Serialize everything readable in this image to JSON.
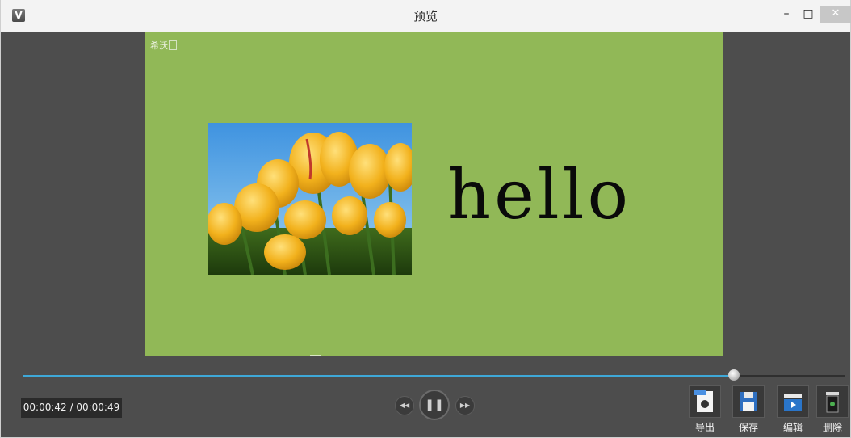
{
  "window": {
    "title": "预览",
    "app_icon": "V",
    "minimize": "–",
    "maximize": "□",
    "close": "✕"
  },
  "preview": {
    "background_color": "#91b857",
    "watermark": "希沃",
    "text": "hello",
    "image": "tulips-photo"
  },
  "playback": {
    "time": "00:00:42 / 00:00:49",
    "progress": 0.865,
    "accent_color": "#3ea8d8",
    "rewind_icon": "rewind-icon",
    "pause_icon": "pause-icon",
    "forward_icon": "fast-forward-icon"
  },
  "actions": [
    {
      "label": "导出",
      "icon": "export-mp4-icon"
    },
    {
      "label": "保存",
      "icon": "save-floppy-icon"
    },
    {
      "label": "编辑",
      "icon": "edit-clapper-icon"
    },
    {
      "label": "删除",
      "icon": "delete-trash-icon"
    }
  ]
}
